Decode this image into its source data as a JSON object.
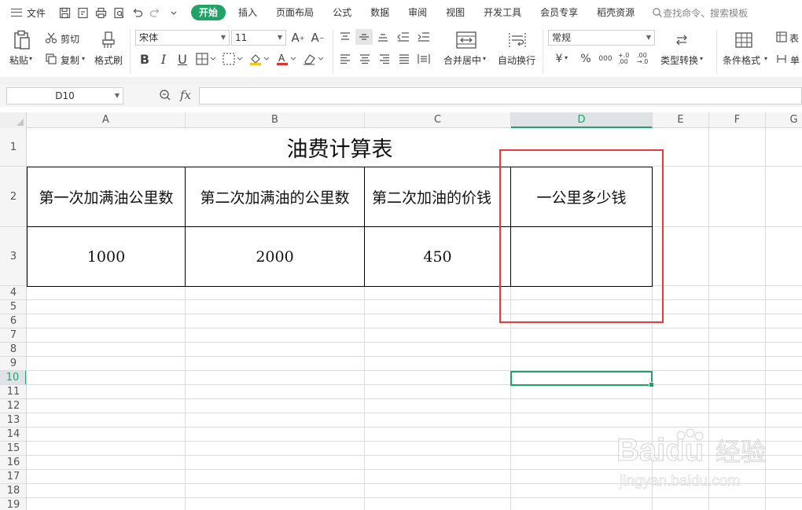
{
  "menubar": {
    "file_label": "文件",
    "tabs": [
      {
        "label": "开始",
        "active": true
      },
      {
        "label": "插入"
      },
      {
        "label": "页面布局"
      },
      {
        "label": "公式"
      },
      {
        "label": "数据"
      },
      {
        "label": "审阅"
      },
      {
        "label": "视图"
      },
      {
        "label": "开发工具"
      },
      {
        "label": "会员专享"
      },
      {
        "label": "稻壳资源"
      }
    ],
    "search_label": "查找命令、搜索模板"
  },
  "ribbon": {
    "paste": "粘贴",
    "cut": "剪切",
    "copy": "复制",
    "format_painter": "格式刷",
    "font_name": "宋体",
    "font_size": "11",
    "merge_center": "合并居中",
    "wrap_text": "自动换行",
    "number_format": "常规",
    "type_convert": "类型转换",
    "conditional_format": "条件格式",
    "table_style": "表",
    "single": "单",
    "currency_symbol": "¥",
    "percent_symbol": "%",
    "thousands_symbol": "000",
    "inc_decimal": "+.0 .00",
    "dec_decimal": ".00 →.0"
  },
  "formula_bar": {
    "cell_ref": "D10",
    "fx": "fx",
    "formula": ""
  },
  "columns": [
    "A",
    "B",
    "C",
    "D",
    "E",
    "F",
    "G"
  ],
  "rows": [
    "1",
    "2",
    "3",
    "4",
    "5",
    "6",
    "7",
    "8",
    "9",
    "10",
    "11",
    "12",
    "13",
    "14",
    "15",
    "16",
    "17",
    "18",
    "19"
  ],
  "selected_column": "D",
  "selected_row": "10",
  "sheet": {
    "title": "油费计算表",
    "headers": [
      "第一次加满油公里数",
      "第二次加满油的公里数",
      "第二次加油的价钱",
      "一公里多少钱"
    ],
    "values": [
      "1000",
      "2000",
      "450",
      ""
    ]
  },
  "watermark": {
    "brand": "Baidu",
    "brand_cn": "经验",
    "url": "jingyan.baidu.com"
  },
  "colors": {
    "accent": "#21a366",
    "highlight_box": "#e83a3a"
  }
}
